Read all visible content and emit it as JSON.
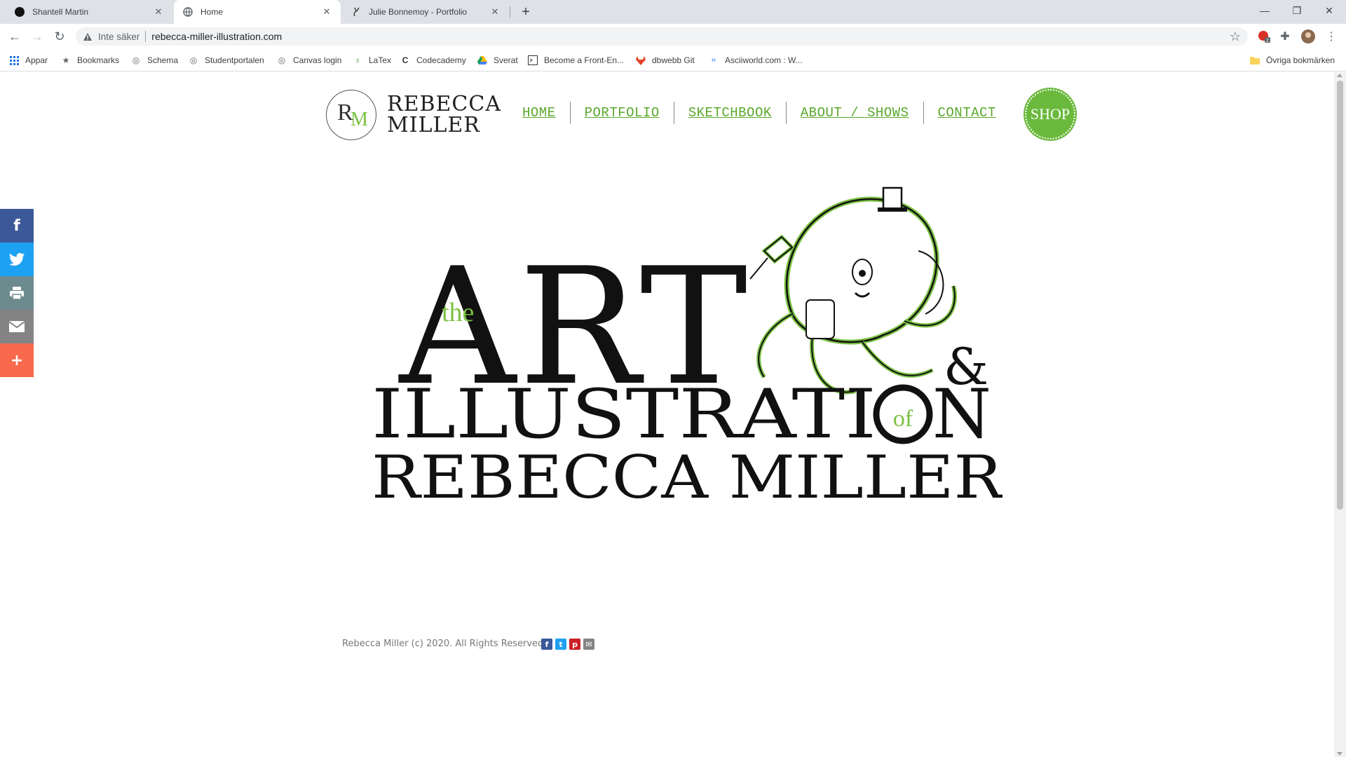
{
  "browser": {
    "tabs": [
      {
        "title": "Shantell Martin",
        "active": false
      },
      {
        "title": "Home",
        "active": true
      },
      {
        "title": "Julie Bonnemoy - Portfolio",
        "active": false
      }
    ],
    "omnibox": {
      "security_label": "Inte säker",
      "url": "rebecca-miller-illustration.com"
    },
    "bookmarks": [
      {
        "label": "Appar",
        "icon": "apps-grid-icon"
      },
      {
        "label": "Bookmarks",
        "icon": "star-icon"
      },
      {
        "label": "Schema",
        "icon": "globe-icon"
      },
      {
        "label": "Studentportalen",
        "icon": "globe-icon"
      },
      {
        "label": "Canvas login",
        "icon": "globe-icon"
      },
      {
        "label": "LaTex",
        "icon": "overleaf-icon"
      },
      {
        "label": "Codecademy",
        "icon": "codecademy-icon"
      },
      {
        "label": "Sverat",
        "icon": "drive-icon"
      },
      {
        "label": "Become a Front-En...",
        "icon": "terminal-icon"
      },
      {
        "label": "dbwebb Git",
        "icon": "gitlab-icon"
      },
      {
        "label": "Asciiworld.com : W...",
        "icon": "ascii-icon"
      }
    ],
    "other_bookmarks": "Övriga bokmärken",
    "extension_badge": "2"
  },
  "site": {
    "logo": {
      "monogram_r": "R",
      "monogram_m": "M",
      "line1": "REBECCA",
      "line2": "MILLER"
    },
    "nav": [
      "HOME",
      "PORTFOLIO",
      "SKETCHBOOK",
      "ABOUT / SHOWS",
      "CONTACT"
    ],
    "shop_label": "SHOP",
    "hero": {
      "the": "the",
      "art": "ART",
      "ampersand": "&",
      "illustration": "ILLUSTRATI",
      "of": "of",
      "n": "N",
      "name": "REBECCA MILLER"
    },
    "footer_text": "Rebecca Miller (c) 2020. All Rights Reserved.",
    "colors": {
      "green": "#6ab93c",
      "nav_green": "#5aa82b",
      "facebook": "#3b5998",
      "twitter": "#1da1f2",
      "print": "#6d8a8e",
      "email": "#848484",
      "more": "#f8694d",
      "pinterest": "#cb2027"
    },
    "social_sidebar": [
      {
        "icon": "facebook-icon",
        "glyph": "f"
      },
      {
        "icon": "twitter-icon",
        "glyph": "t"
      },
      {
        "icon": "print-icon",
        "glyph": "⎙"
      },
      {
        "icon": "email-icon",
        "glyph": "✉"
      },
      {
        "icon": "more-share-icon",
        "glyph": "+"
      }
    ]
  }
}
